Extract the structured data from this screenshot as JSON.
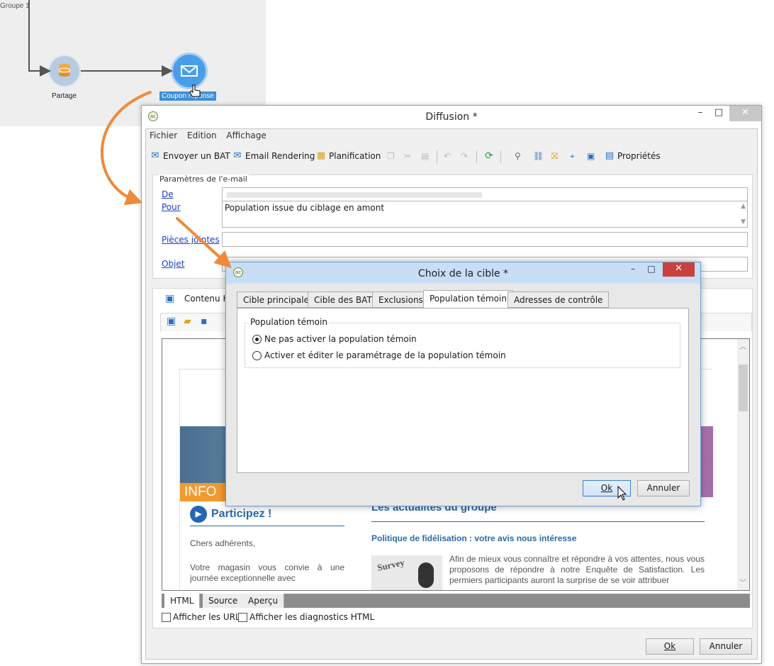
{
  "workflow": {
    "node1_label": "Partage",
    "transition_label": "Groupe 1",
    "node2_label": "Coupon réponse"
  },
  "window": {
    "title": "Diffusion *",
    "controls": {
      "minimize": "–",
      "maximize": "□",
      "close": "✕"
    },
    "menu": [
      "Fichier",
      "Edition",
      "Affichage"
    ],
    "toolbar": {
      "send_proof": "Envoyer un BAT",
      "email_rendering": "Email Rendering",
      "planning": "Planification",
      "properties": "Propriétés"
    }
  },
  "email_params": {
    "legend": "Paramètres de l'e-mail",
    "from_label": "De",
    "from_value": "",
    "to_label": "Pour",
    "to_value": "Population issue du ciblage en amont",
    "attachments_label": "Pièces jointes",
    "subject_label": "Objet",
    "subject_value": ""
  },
  "content": {
    "tab_label": "Contenu HTML",
    "preview": {
      "info_badge": "INFO",
      "participate_title": "Participez !",
      "news_title": "Les actualités du groupe",
      "policy_heading": "Politique de fidélisation : votre avis nous intéresse",
      "greeting": "Chers adhérents,",
      "invitation": "Votre magasin vous convie à une journée exceptionnelle avec",
      "survey_text": "Afin de mieux vous connaître et répondre à vos attentes, nous vous proposons de répondre à notre Enquête de Satisfaction. Les permiers participants auront la surprise de se voir attribuer",
      "survey_image_text": "Survey"
    },
    "bottom_tabs": [
      "HTML",
      "Source",
      "Aperçu"
    ],
    "show_urls": "Afficher les URL",
    "show_diagnostics": "Afficher les diagnostics HTML"
  },
  "main_buttons": {
    "ok": "Ok",
    "cancel": "Annuler"
  },
  "dialog": {
    "title": "Choix de la cible *",
    "tabs": [
      "Cible principale",
      "Cible des BAT",
      "Exclusions",
      "Population témoin",
      "Adresses de contrôle"
    ],
    "active_tab": "Population témoin",
    "group_legend": "Population témoin",
    "option1": "Ne pas activer la population témoin",
    "option2": "Activer et éditer le paramétrage de la population témoin",
    "selected_option": 1,
    "ok": "Ok",
    "cancel": "Annuler"
  },
  "colors": {
    "accent_arrow": "#f08a3a",
    "link": "#1b3fc4",
    "node_active": "#4a9ee8",
    "close_button": "#c9413c",
    "brand_blue": "#2a6aa7",
    "info_orange": "#f29a2e"
  }
}
